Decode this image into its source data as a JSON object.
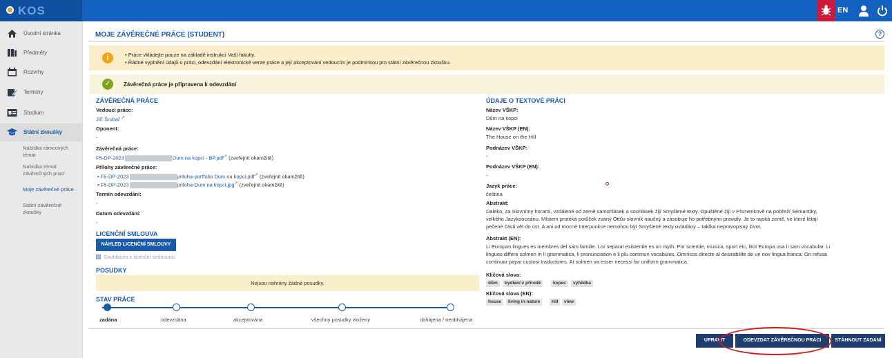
{
  "app": {
    "logo_text": "KOS",
    "lang": "EN"
  },
  "sidebar": {
    "items": [
      {
        "label": "Úvodní stránka"
      },
      {
        "label": "Předměty"
      },
      {
        "label": "Rozvrhy"
      },
      {
        "label": "Termíny"
      },
      {
        "label": "Studium"
      },
      {
        "label": "Státní zkoušky"
      }
    ],
    "sub_items": [
      {
        "line1": "Nabídka rámcových",
        "line2": "témat"
      },
      {
        "line1": "Nabídka témat",
        "line2": "závěrečných prací"
      },
      {
        "line1": "Moje závěrečné práce",
        "line2": ""
      },
      {
        "line1": "Státní závěrečné",
        "line2": "zkoušky"
      }
    ]
  },
  "page": {
    "title": "MOJE ZÁVĚREČNÉ PRÁCE (STUDENT)",
    "help": "?"
  },
  "alerts": {
    "info_lines": [
      "• Práce vkládejte pouze na základě instrukcí Vaší fakulty.",
      "• Řádné vyplnění údajů o práci, odevzdání elektronické verze práce a její akceptování vedoucím je podmínkou pro státní závěrečnou zkoušku."
    ],
    "ok_text": "Závěrečná práce je připravena k odevzdání"
  },
  "thesis": {
    "heading": "ZÁVĚREČNÁ PRÁCE",
    "supervisor_label": "Vedoucí práce:",
    "supervisor": "Jiří Šrubař",
    "opponent_label": "Oponent:",
    "opponent": "-",
    "work_label": "Závěrečná práce:",
    "work_prefix": "F5-DP-2023",
    "work_file": "Dum na kopci - BP.pdf",
    "work_note": "(zveřejnit okamžitě)",
    "attachments_label": "Přílohy závěrečné práce:",
    "attachments": [
      {
        "prefix": "• F5-DP-2023",
        "file": "priloha-portfolio Dum na kopci.pdf",
        "note": "(zveřejnit okamžitě)"
      },
      {
        "prefix": "• F5-DP-2023",
        "file": "priloha-Dum na kopci.jpg",
        "note": "(zveřejnit okamžitě)"
      }
    ],
    "deadline_label": "Termín odevzdání:",
    "deadline": "-",
    "submitted_label": "Datum odevzdání:",
    "submitted": "-"
  },
  "license": {
    "heading": "LICENČNÍ SMLOUVA",
    "button": "NÁHLED LICENČNÍ SMLOUVY",
    "checkbox_label": "Souhlasím s licenční smlouvou",
    "checked": true
  },
  "reviews": {
    "heading": "POSUDKY",
    "empty": "Nejsou nahrány žádné posudky."
  },
  "status": {
    "heading": "STAV PRÁCE",
    "steps": [
      "zadána",
      "odevzdána",
      "akceptována",
      "všechny posudky vloženy",
      "obhájena / neobhájena"
    ],
    "current_index": 0
  },
  "text_info": {
    "heading": "ÚDAJE O TEXTOVÉ PRÁCI",
    "name_label": "Název VŠKP:",
    "name": "Dům na kopci",
    "name_en_label": "Název VŠKP (EN):",
    "name_en": "The House on the Hill",
    "subtitle_label": "Podnázev VŠKP:",
    "subtitle": "-",
    "subtitle_en_label": "Podnázev VŠKP (EN):",
    "subtitle_en": "-",
    "language_label": "Jazyk práce:",
    "language": "čeština",
    "abstract_label": "Abstrakt:",
    "abstract_lines": [
      "Daleko, za Slovnímy horami, vzdálené od země samohlásek a souhlásek žijí Smyšlené texty. Opuštěné žijí v Písmenkově na pobřeží Sémantiky,",
      "velkého Jazykooceánu. Místem protéká potůček zvaný Ottův slovník naučný a zásobuje ho potřebnými pravidly. Je to rajská země, ve které létají",
      "pečené části vět do úst. A ani od mocné Interpunkce nemohou být Smyšlené texty ovládány – takřka nepravopisný život."
    ],
    "abstract_en_label": "Abstrakt (EN):",
    "abstract_en_lines": [
      "Li Europan lingues es membres del sam familie. Lor separat existentie es un myth. Por scientie, musica, sport etc, litot Europa usa li sam vocabular. Li",
      "lingues differe solmen in li grammatica, li pronunciation e li plu commun vocabules. Omnicos directe al desirabilite de un nov lingua franca: On refusa",
      "continuar payar custosi traductores. At solmen va esser necessi far uniform grammatica."
    ],
    "keywords_label": "Klíčová slova:",
    "keywords": [
      "dům",
      "bydlení v přírodě",
      "kopec",
      "vyhlídka"
    ],
    "keywords_en_label": "Klíčová slova (EN):",
    "keywords_en": [
      "house",
      "living in nature",
      "hill",
      "view"
    ]
  },
  "actions": {
    "edit": "UPRAVIT",
    "submit": "ODEVZDAT ZÁVĚREČNOU PRÁCI",
    "withdraw": "STÁHNOUT ZADÁNÍ"
  },
  "colors": {
    "topbar": "#1361c0",
    "accent": "#1a5aa6",
    "warning_bg": "#fbeecb",
    "annotation": "#d01c1c"
  }
}
